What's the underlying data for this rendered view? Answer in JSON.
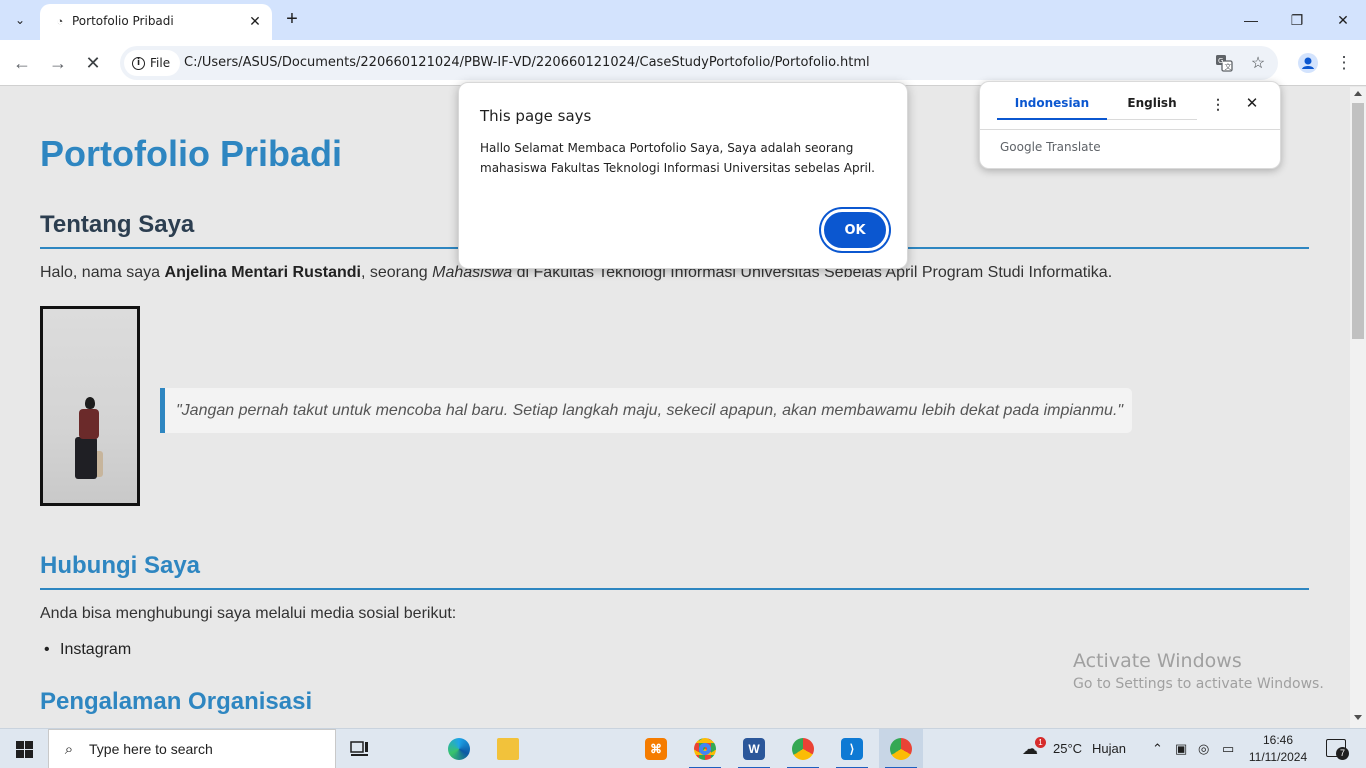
{
  "browser": {
    "tab_title": "Portofolio Pribadi",
    "chip_label": "File",
    "url": "C:/Users/ASUS/Documents/220660121024/PBW-IF-VD/220660121024/CaseStudyPortofolio/Portofolio.html"
  },
  "page": {
    "title": "Portofolio Pribadi",
    "about": {
      "heading": "Tentang Saya",
      "intro_prefix": "Halo, nama saya ",
      "name": "Anjelina Mentari Rustandi",
      "intro_mid": ", seorang ",
      "role": "Mahasiswa",
      "intro_suffix": " di Fakultas Teknologi Informasi Universitas Sebelas April Program Studi Informatika.",
      "quote": "\"Jangan pernah takut untuk mencoba hal baru. Setiap langkah maju, sekecil apapun, akan membawamu lebih dekat pada impianmu.\""
    },
    "contact": {
      "heading": "Hubungi Saya",
      "text": "Anda bisa menghubungi saya melalui media sosial berikut:",
      "items": [
        "Instagram"
      ]
    },
    "experience": {
      "heading": "Pengalaman Organisasi"
    }
  },
  "dialog": {
    "title": "This page says",
    "message": "Hallo Selamat Membaca Portofolio Saya, Saya adalah seorang mahasiswa Fakultas Teknologi Informasi Universitas sebelas April.",
    "ok_label": "OK"
  },
  "translate": {
    "lang_source": "Indonesian",
    "lang_target": "English",
    "brand": "Google Translate"
  },
  "watermark": {
    "line1": "Activate Windows",
    "line2": "Go to Settings to activate Windows."
  },
  "taskbar": {
    "search_placeholder": "Type here to search",
    "weather_temp": "25°C",
    "weather_text": "Hujan",
    "weather_badge": "1",
    "time": "16:46",
    "date": "11/11/2024",
    "notification_count": "7"
  },
  "colors": {
    "accent_blue": "#2e86c1",
    "heading_dark": "#2c3e50",
    "dialog_button": "#0b57d0"
  }
}
